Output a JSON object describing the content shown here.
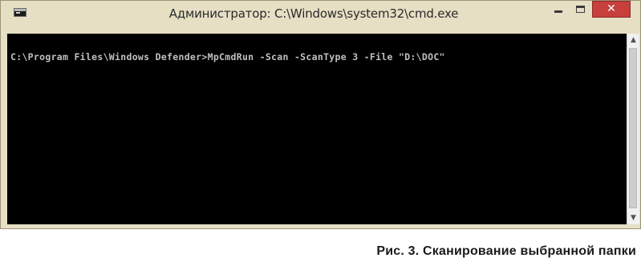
{
  "window": {
    "title": "Администратор: C:\\Windows\\system32\\cmd.exe",
    "close_glyph": "✕",
    "icons": {
      "app": "console-app-icon",
      "minimize": "minimize-icon",
      "maximize": "maximize-icon",
      "close": "close-icon"
    }
  },
  "console": {
    "line1": "C:\\Program Files\\Windows Defender>MpCmdRun -Scan -ScanType 3 -File \"D:\\DOC\""
  },
  "scrollbar": {
    "up_glyph": "▲",
    "down_glyph": "▼"
  },
  "caption": "Рис. 3. Сканирование выбранной папки",
  "colors": {
    "frame": "#e6dfc4",
    "close_button": "#c7403c",
    "console_bg": "#000000",
    "console_fg": "#c0c0c0"
  }
}
